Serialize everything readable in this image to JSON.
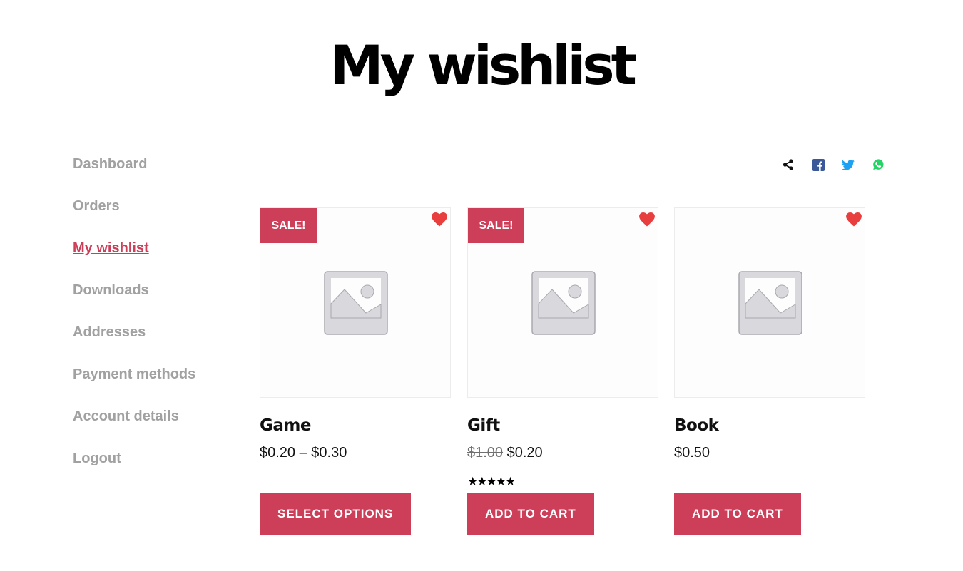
{
  "page": {
    "title": "My wishlist"
  },
  "nav": {
    "items": [
      {
        "label": "Dashboard"
      },
      {
        "label": "Orders"
      },
      {
        "label": "My wishlist",
        "active": true
      },
      {
        "label": "Downloads"
      },
      {
        "label": "Addresses"
      },
      {
        "label": "Payment methods"
      },
      {
        "label": "Account details"
      },
      {
        "label": "Logout"
      }
    ]
  },
  "share": {
    "icons": [
      "share-icon",
      "facebook-icon",
      "twitter-icon",
      "whatsapp-icon"
    ]
  },
  "products": [
    {
      "name": "Game",
      "sale_badge": "SALE!",
      "price": "$0.20 – $0.30",
      "button": "SELECT OPTIONS"
    },
    {
      "name": "Gift",
      "sale_badge": "SALE!",
      "regular_price": "$1.00",
      "price": "$0.20",
      "rating": 5,
      "rating_stars": "★★★★★",
      "button": "ADD TO CART"
    },
    {
      "name": "Book",
      "price": "$0.50",
      "button": "ADD TO CART"
    }
  ],
  "colors": {
    "accent": "#cd3e59",
    "nav_inactive": "#a1a1a1",
    "heart": "#e83e3e",
    "facebook": "#3b5998",
    "twitter": "#1da1f2",
    "whatsapp": "#25d366"
  }
}
